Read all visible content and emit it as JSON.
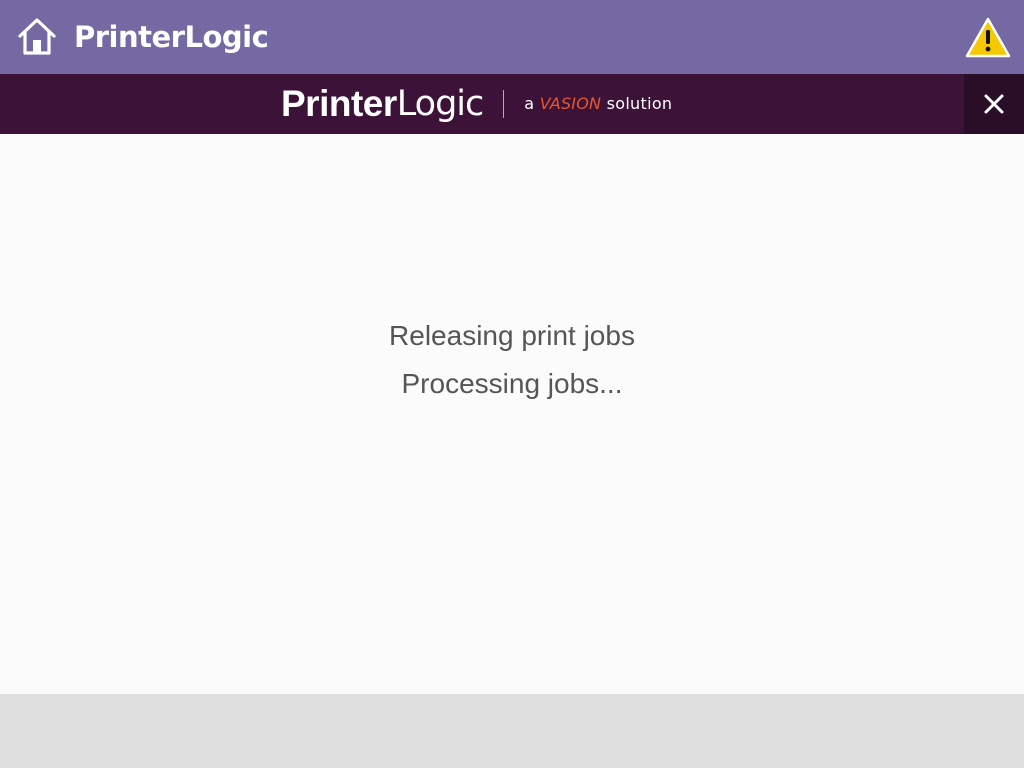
{
  "header": {
    "title": "PrinterLogic",
    "home_icon": "home-icon",
    "warning_icon": "warning-icon",
    "background_color": "#7469a2"
  },
  "banner": {
    "brand_bold": "Printer",
    "brand_light": "Logic",
    "tagline_prefix": "a ",
    "tagline_brand": "VASION",
    "tagline_suffix": " solution",
    "tagline_brand_color": "#e8582a",
    "close_icon": "close-icon",
    "background_color": "#3d1238"
  },
  "main": {
    "status_title": "Releasing print jobs",
    "status_detail": "Processing jobs..."
  }
}
